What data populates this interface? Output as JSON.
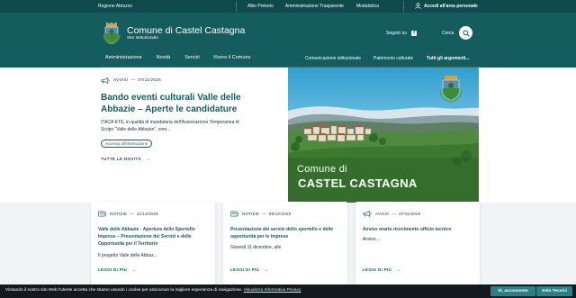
{
  "topbar": {
    "region": "Regione Abruzzo",
    "links": [
      "Albo Pretorio",
      "Amministrazione Trasparente",
      "Modulistica"
    ],
    "access": "Accedi all'area personale"
  },
  "header": {
    "title": "Comune di Castel Castagna",
    "subtitle": "Sito Istituzionale",
    "follow": "Seguici su",
    "search": "Cerca"
  },
  "nav": {
    "main": [
      "Amministrazione",
      "Novità",
      "Servizi",
      "Vivere il Comune"
    ],
    "secondary": [
      "Comunicazione istituzionale",
      "Patrimonio culturale",
      "Tutti gli argomenti..."
    ]
  },
  "hero": {
    "category": "AVVISI",
    "date": "07/11/2025",
    "title": "Bando eventi culturali Valle delle Abbazie – Aperte le candidature",
    "text": "ITACA ETS, in qualità di mandataria dell'Associazione Temporanea di Scopo \"Valle delle Abbazie\", com...",
    "chip": "Accesso all'informazione",
    "all_link": "TUTTE LE NOVITÀ",
    "photo_caption_1": "Comune di",
    "photo_caption_2": "CASTEL CASTAGNA"
  },
  "cards": [
    {
      "category": "NOTIZIE",
      "date": "11/12/2025",
      "title": "Valle delle Abbazie - Apertura dello Sportello Imprese – Presentazione dei Servizi e delle Opportunità per il Territorio",
      "text": "Il progetto Valle delle Abbaz...",
      "more": "LEGGI DI PIÙ"
    },
    {
      "category": "NOTIZIE",
      "date": "09/12/2025",
      "title": "Presentazione dei servizi dello sportello e delle opportunità per le imprese",
      "text": "Giovedì 11 dicembre, alle",
      "more": "LEGGI DI PIÙ"
    },
    {
      "category": "AVVISI",
      "date": "27/11/2025",
      "title": "Avviso orario ricevimento ufficio tecnico",
      "text": "Avviso ...",
      "more": "LEGGI DI PIÙ"
    }
  ],
  "cookie": {
    "message": "Visitando il nostro sito Web l'utente accetta che stiamo usando i cookie per assicurare la migliore esperienza di navigazione.",
    "policy_link": "Visualizza Informativa Privacy",
    "accept": "Sì, acconsento",
    "technical": "Solo Tecnici"
  },
  "colors": {
    "topbar": "#0e4a4c",
    "header": "#155c5f",
    "accent": "#155c5f",
    "page_bg": "#f1f4f4",
    "cookie_bar": "#13191d",
    "cookie_button": "#2e7f83"
  }
}
